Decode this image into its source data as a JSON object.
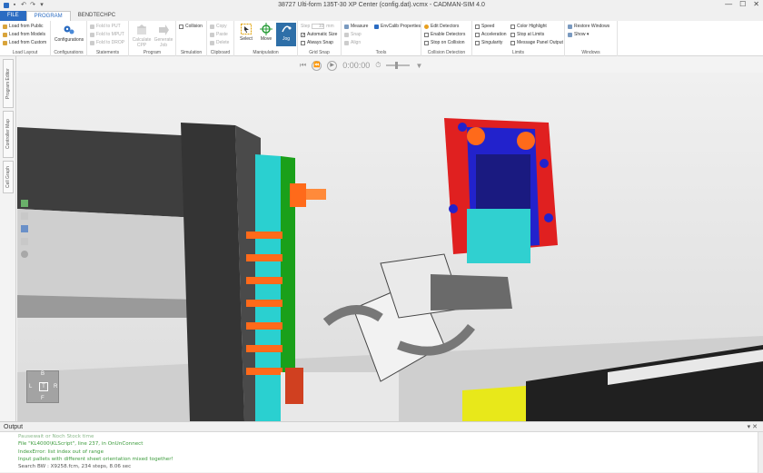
{
  "window": {
    "title": "38727 Ulti-form 135T-30 XP Center (config.dat).vcmx - CADMAN-SIM 4.0",
    "controls": [
      "—",
      "☐",
      "✕"
    ]
  },
  "tabs": [
    "FILE",
    "PROGRAM",
    "BENDTECHPC"
  ],
  "ribbon": {
    "load_layout": {
      "label": "Load Layout",
      "items": [
        "Load from Public",
        "Load from Models",
        "Load from Custom"
      ]
    },
    "configurations": {
      "label": "Configurations",
      "button": "Configurations"
    },
    "statements": {
      "label": "Statements",
      "items": [
        "Fold to PUT",
        "Fold to MPUT",
        "Fold to DROP"
      ]
    },
    "program": {
      "label": "Program",
      "calc": "Calculate CPP",
      "gen": "Generate Job"
    },
    "simulation": {
      "label": "Simulation",
      "collision": "Collision"
    },
    "clipboard": {
      "label": "Clipboard",
      "items": [
        "Copy",
        "Paste",
        "Delete"
      ]
    },
    "manipulation": {
      "label": "Manipulation",
      "select": "Select",
      "move": "Move",
      "jog": "Jog"
    },
    "grid_snap": {
      "label": "Grid Snap",
      "step_label": "Step",
      "step_value": "10",
      "step_unit": "mm",
      "auto_size": "Automatic Size",
      "always_snap": "Always Snap"
    },
    "tools": {
      "label": "Tools",
      "measure": "Measure",
      "snap": "Snap",
      "align": "Align",
      "envcalib": "EnvCalib Properties"
    },
    "collision_detection": {
      "label": "Collision Detection",
      "items": [
        "Edit Detectors",
        "Enable Detectors",
        "Stop on Collision"
      ]
    },
    "limits": {
      "label": "Limits",
      "col1": [
        "Speed",
        "Acceleration",
        "Singularity"
      ],
      "col2": [
        "Color Highlight",
        "Stop at Limits",
        "Message Panel Output"
      ]
    },
    "windows": {
      "label": "Windows",
      "items": [
        "Restore Windows",
        "Show ▾"
      ]
    }
  },
  "playbar": {
    "time": "0:00:00"
  },
  "side_tabs": [
    "Program Editor",
    "Controller Map",
    "Cell Graph"
  ],
  "navcube": {
    "top": "B",
    "left": "L",
    "center": "T",
    "right": "R",
    "bottom": "F"
  },
  "output": {
    "title": "Output",
    "controls": "▾ ✕",
    "lines": [
      {
        "text": "Pausewait or Noch Stock time",
        "style": "faded"
      },
      {
        "text": "  File \"KL4000\\KLScript\", line 237, in OnUnConnect",
        "style": "green"
      },
      {
        "text": "IndexError: list index out of range",
        "style": "green"
      },
      {
        "text": "Input pallets with different sheet orientation mixed together!",
        "style": "green"
      },
      {
        "text": "Search BW : X9258.fcm, 234 steps, 8.06 sec",
        "style": "gray"
      }
    ]
  },
  "colors": {
    "accent": "#2b6cc2",
    "robot_red": "#e02020",
    "robot_blue": "#2222cc",
    "fixture_orange": "#ff6a1a",
    "conveyor_yellow": "#e8e81a",
    "output_green": "#3c9b3c"
  }
}
